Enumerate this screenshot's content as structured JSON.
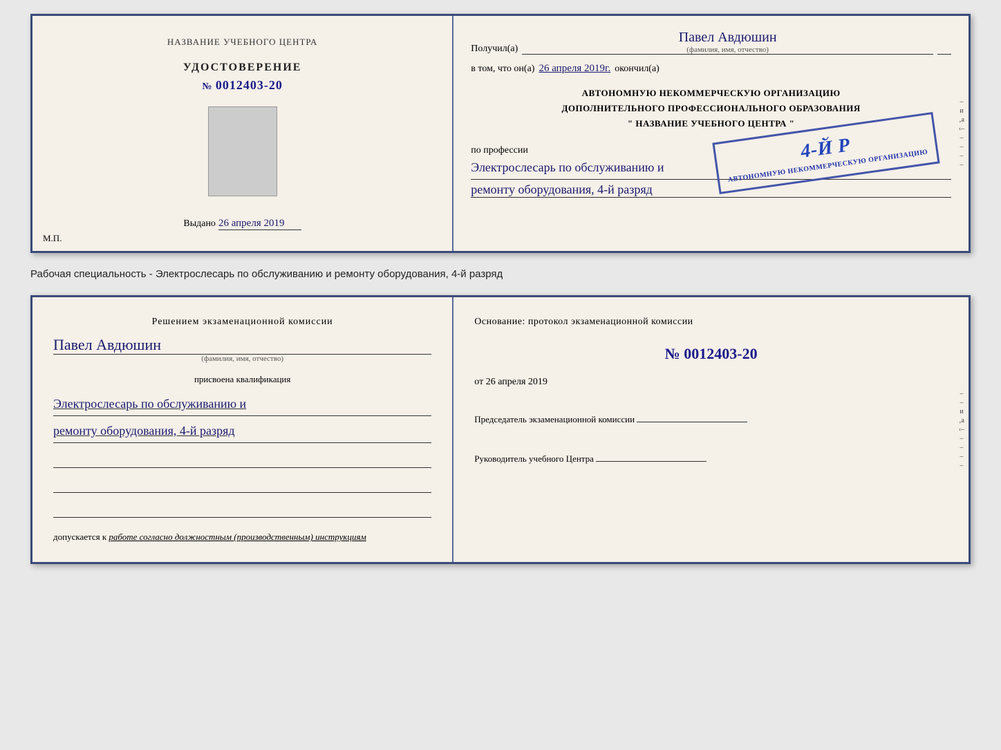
{
  "top_left": {
    "center_text": "НАЗВАНИЕ УЧЕБНОГО ЦЕНТРА",
    "cert_label": "УДОСТОВЕРЕНИЕ",
    "cert_number_prefix": "№",
    "cert_number": "0012403-20",
    "issue_label": "Выдано",
    "issue_date": "26 апреля 2019",
    "mp_label": "М.П."
  },
  "top_right": {
    "recipient_label": "Получил(а)",
    "recipient_name": "Павел Авдюшин",
    "fio_hint": "(фамилия, имя, отчество)",
    "dash": "–",
    "vtom_text": "в том, что он(а)",
    "vtom_date": "26 апреля 2019г.",
    "okoncil": "окончил(а)",
    "stamp_line1": "АВТОНОМНУЮ НЕКОММЕРЧЕСКУЮ ОРГАНИЗАЦИЮ",
    "stamp_line2": "ДОПОЛНИТЕЛЬНОГО ПРОФЕССИОНАЛЬНОГО ОБРАЗОВАНИЯ",
    "stamp_line3": "\" НАЗВАНИЕ УЧЕБНОГО ЦЕНТРА \"",
    "stamp_number": "4-й р",
    "profession_label": "по профессии",
    "profession_line1": "Электрослесарь по обслуживанию и",
    "profession_line2": "ремонту оборудования, 4-й разряд"
  },
  "description": "Рабочая специальность - Электрослесарь по обслуживанию и ремонту оборудования, 4-й разряд",
  "bottom_left": {
    "commission_text": "Решением экзаменационной комиссии",
    "person_name": "Павел Авдюшин",
    "fio_hint": "(фамилия, имя, отчество)",
    "assigned_label": "присвоена квалификация",
    "qual_line1": "Электрослесарь по обслуживанию и",
    "qual_line2": "ремонту оборудования, 4-й разряд",
    "допускается_text": "допускается к",
    "допускается_detail": "работе согласно должностным (производственным) инструкциям"
  },
  "bottom_right": {
    "osnov_text": "Основание: протокол экзаменационной комиссии",
    "number_prefix": "№",
    "number": "0012403-20",
    "date_prefix": "от",
    "date": "26 апреля 2019",
    "chairman_title": "Председатель экзаменационной комиссии",
    "rukovoditel_title": "Руководитель учебного Центра"
  },
  "side_chars": [
    "–",
    "и",
    "‚а",
    "‹–",
    "–",
    "–",
    "–",
    "–"
  ]
}
